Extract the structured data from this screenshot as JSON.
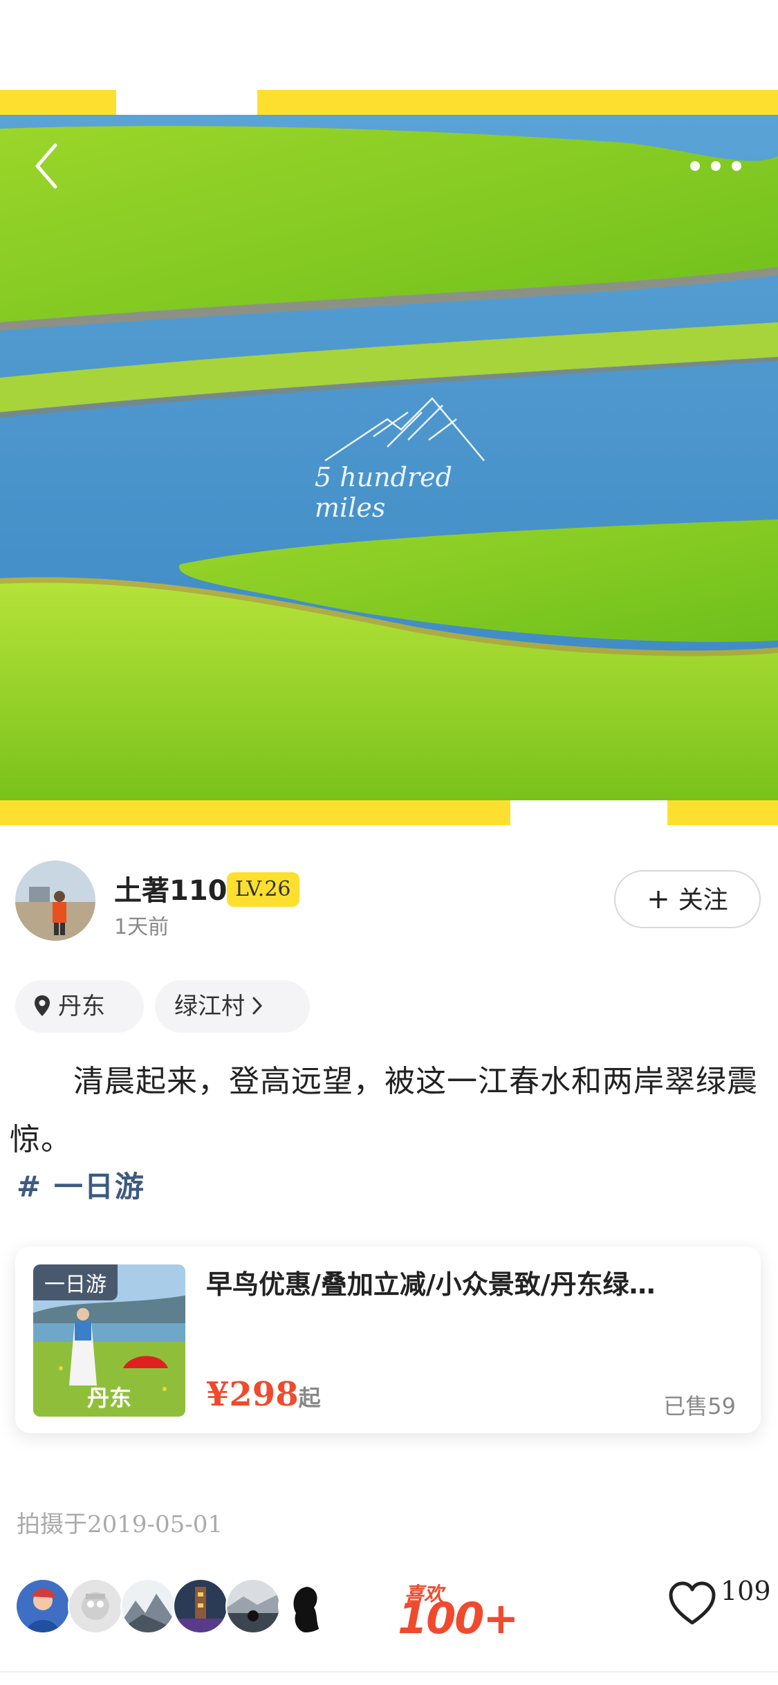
{
  "hero": {
    "watermark_text": "5 hundred miles"
  },
  "author": {
    "name": "土著110",
    "level": "LV.26",
    "time": "1天前",
    "follow_label": "关注"
  },
  "location": {
    "city": "丹东",
    "village": "绿江村"
  },
  "post": {
    "text": "清晨起来，登高远望，被这一江春水和两岸翠绿震惊。",
    "topic": "# 一日游"
  },
  "product": {
    "tag": "一日游",
    "city": "丹东",
    "title": "早鸟优惠/叠加立减/小众景致/丹东绿…",
    "price": "¥298",
    "price_suffix": "起",
    "sold": "已售59"
  },
  "footer": {
    "shot_date": "拍摄于2019-05-01",
    "likes_badge_top": "喜欢",
    "likes_badge_num": "100+",
    "like_count": "109"
  },
  "colors": {
    "accent_yellow": "#fde02f",
    "price_red": "#f04a2e",
    "topic_blue": "#3d5a80"
  },
  "icons": [
    "back-arrow-icon",
    "more-dots-icon",
    "plus-icon",
    "location-pin-icon",
    "chevron-right-icon",
    "heart-icon"
  ]
}
